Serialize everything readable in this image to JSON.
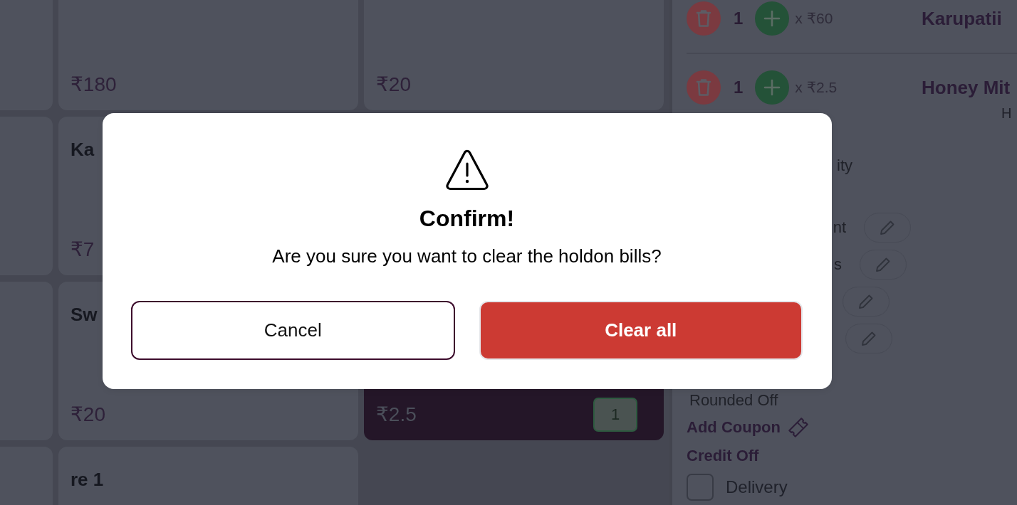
{
  "product_grid": {
    "rows": [
      [
        {
          "selected": false
        },
        {
          "price": "₹180",
          "selected": false
        },
        {
          "price": "₹20",
          "selected": false
        }
      ],
      [
        {
          "selected": false
        },
        {
          "title": "Ka",
          "price": "₹7",
          "selected": false
        }
      ],
      [
        {
          "selected": false
        },
        {
          "title": "Sw",
          "price": "₹20",
          "selected": false
        },
        {
          "price": "₹2.5",
          "quantity": "1",
          "selected": true
        }
      ],
      [
        {
          "selected": false
        },
        {
          "title": "re 1",
          "selected": false
        }
      ]
    ]
  },
  "cart": {
    "items": [
      {
        "quantity": "1",
        "unit_price": "x ₹60",
        "name": "Karupatii"
      },
      {
        "quantity": "1",
        "unit_price": "x ₹2.5",
        "name": "Honey Mit",
        "subtitle": "H"
      }
    ],
    "summary_rows": [
      {
        "label": "ity",
        "editable": false
      },
      {
        "label": "nt",
        "editable": true
      },
      {
        "label": "s",
        "editable": true
      },
      {
        "editable": true
      },
      {
        "editable": true
      }
    ],
    "rounded_off": "Rounded Off",
    "add_coupon": "Add Coupon",
    "credit_off": "Credit Off",
    "delivery": {
      "label": "Delivery",
      "checked": false
    }
  },
  "dialog": {
    "title": "Confirm!",
    "message": "Are you sure you want to clear the holdon bills?",
    "buttons": [
      {
        "label": "Cancel",
        "kind": "secondary"
      },
      {
        "label": "Clear all",
        "kind": "danger"
      }
    ]
  }
}
